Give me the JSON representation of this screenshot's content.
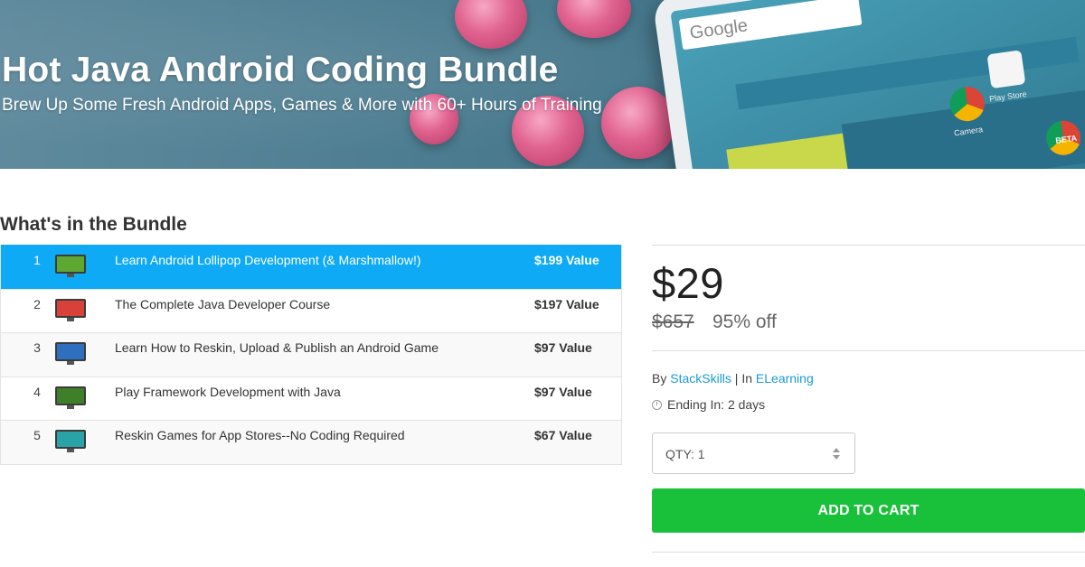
{
  "hero": {
    "title": "Hot Java Android Coding Bundle",
    "subtitle": "Brew Up Some Fresh Android Apps, Games & More with 60+ Hours of Training",
    "phone_search_text": "Google",
    "app_labels": [
      "Play Store",
      "Camera",
      "BETA"
    ]
  },
  "section": {
    "title": "What's in the Bundle"
  },
  "bundle": {
    "items": [
      {
        "number": "1",
        "title": "Learn Android Lollipop Development (& Marshmallow!)",
        "value": "$199 Value",
        "thumb_color": "#5ea832",
        "active": true
      },
      {
        "number": "2",
        "title": "The Complete Java Developer Course",
        "value": "$197 Value",
        "thumb_color": "#d8413a",
        "active": false
      },
      {
        "number": "3",
        "title": "Learn How to Reskin, Upload & Publish an Android Game",
        "value": "$97 Value",
        "thumb_color": "#2f6fc0",
        "active": false
      },
      {
        "number": "4",
        "title": "Play Framework Development with Java",
        "value": "$97 Value",
        "thumb_color": "#3f7f2a",
        "active": false
      },
      {
        "number": "5",
        "title": "Reskin Games for App Stores--No Coding Required",
        "value": "$67 Value",
        "thumb_color": "#2aa3a8",
        "active": false
      }
    ]
  },
  "purchase": {
    "price": "$29",
    "old_price": "$657",
    "discount": "95% off",
    "by_prefix": "By ",
    "vendor": "StackSkills",
    "in_prefix": " | In ",
    "category": "ELearning",
    "ending": "Ending In: 2 days",
    "qty_label": "QTY: 1",
    "add_to_cart": "ADD TO CART"
  },
  "colors": {
    "accent_blue": "#0eaaf5",
    "link_blue": "#1a9ad6",
    "cart_green": "#19c13a"
  }
}
